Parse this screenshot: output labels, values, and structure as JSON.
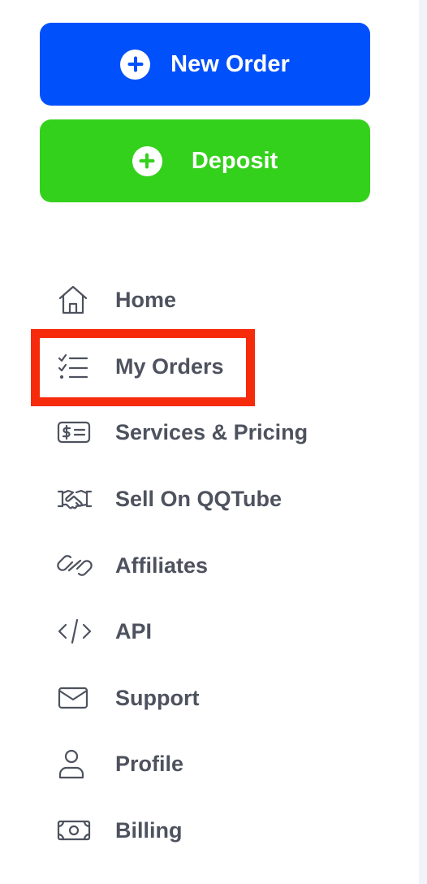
{
  "actions": {
    "new_order": "New Order",
    "deposit": "Deposit"
  },
  "nav": {
    "items": [
      {
        "label": "Home",
        "icon": "home-icon"
      },
      {
        "label": "My Orders",
        "icon": "checklist-icon"
      },
      {
        "label": "Services & Pricing",
        "icon": "price-tag-icon"
      },
      {
        "label": "Sell On QQTube",
        "icon": "handshake-icon"
      },
      {
        "label": "Affiliates",
        "icon": "link-icon"
      },
      {
        "label": "API",
        "icon": "code-icon"
      },
      {
        "label": "Support",
        "icon": "mail-icon"
      },
      {
        "label": "Profile",
        "icon": "user-icon"
      },
      {
        "label": "Billing",
        "icon": "banknote-icon"
      }
    ],
    "highlighted": "My Orders"
  },
  "colors": {
    "new_order_bg": "#0050fb",
    "deposit_bg": "#34d11c",
    "nav_text": "#4d525e",
    "highlight_border": "#f52b0b"
  }
}
